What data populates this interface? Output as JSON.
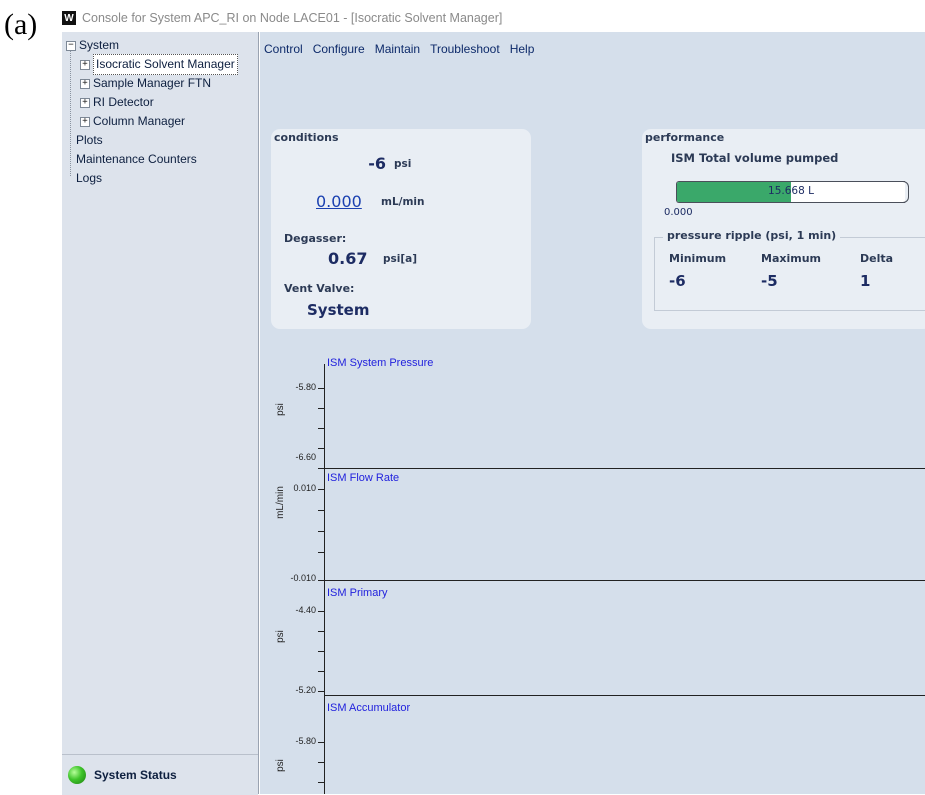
{
  "figure_label": "(a)",
  "window": {
    "icon_letter": "W",
    "title": "Console for System APC_RI on Node LACE01 - [Isocratic Solvent Manager]"
  },
  "tree": {
    "root": {
      "toggle": "−",
      "label": "System"
    },
    "children": [
      {
        "toggle": "+",
        "label": "Isocratic Solvent Manager",
        "selected": true
      },
      {
        "toggle": "+",
        "label": "Sample Manager FTN"
      },
      {
        "toggle": "+",
        "label": "RI Detector"
      },
      {
        "toggle": "+",
        "label": "Column Manager"
      }
    ],
    "items": [
      "Plots",
      "Maintenance Counters",
      "Logs"
    ]
  },
  "status": {
    "label": "System Status",
    "color": "#3ec42a"
  },
  "menu": [
    "Control",
    "Configure",
    "Maintain",
    "Troubleshoot",
    "Help"
  ],
  "conditions": {
    "title": "conditions",
    "pressure": {
      "value": "-6",
      "unit": "psi"
    },
    "flow": {
      "value": "0.000",
      "unit": "mL/min"
    },
    "degasser": {
      "label": "Degasser:",
      "value": "0.67",
      "unit": "psi[a]"
    },
    "vent": {
      "label": "Vent Valve:",
      "value": "System"
    }
  },
  "performance": {
    "title": "performance",
    "volume_label": "ISM Total volume pumped",
    "volume_text": "15.668 L",
    "volume_fill_fraction": 0.5,
    "volume_min": "0.000",
    "ripple": {
      "title": "pressure ripple (psi, 1 min)",
      "headers": [
        "Minimum",
        "Maximum",
        "Delta"
      ],
      "values": [
        "-6",
        "-5",
        "1"
      ]
    }
  },
  "plots": [
    {
      "title": "ISM System Pressure",
      "ylabel": "psi",
      "top_tick": "-5.80",
      "bottom_tick": "-6.60"
    },
    {
      "title": "ISM Flow Rate",
      "ylabel": "mL/min",
      "top_tick": "0.010",
      "bottom_tick": "-0.010"
    },
    {
      "title": "ISM Primary",
      "ylabel": "psi",
      "top_tick": "-4.40",
      "bottom_tick": "-5.20"
    },
    {
      "title": "ISM Accumulator",
      "ylabel": "psi",
      "top_tick": "-5.80",
      "bottom_tick": ""
    }
  ],
  "colors": {
    "accent_fill": "#3aa86a",
    "plot_title": "#2222dd",
    "sidebar_bg": "#dde3ec",
    "main_bg": "#d5dfeb"
  }
}
